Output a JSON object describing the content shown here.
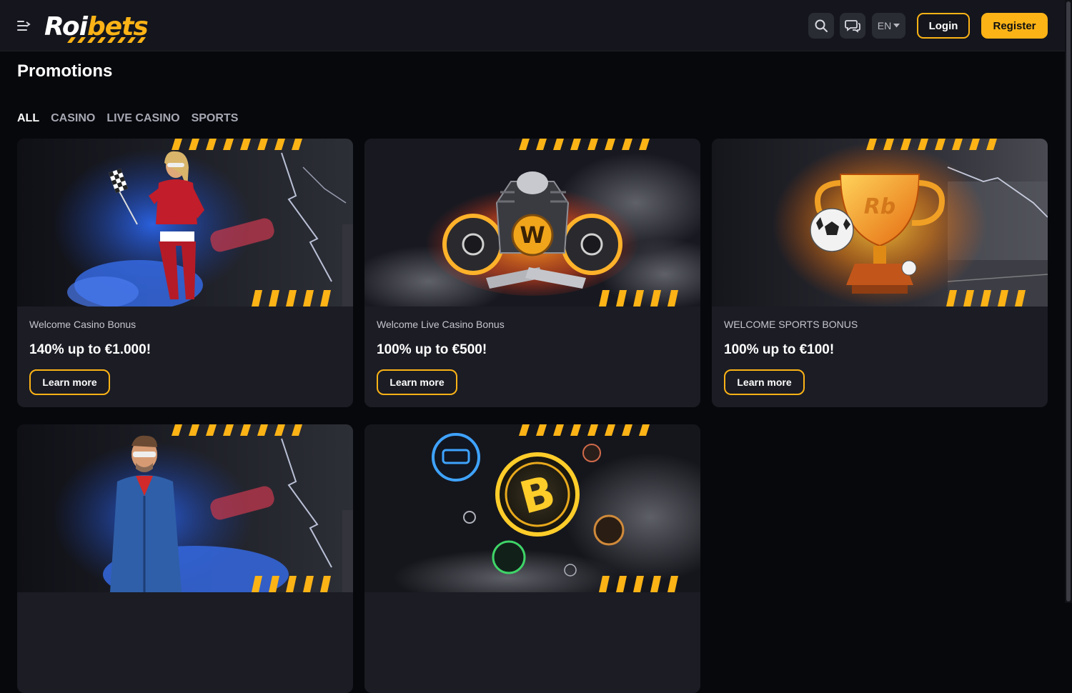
{
  "header": {
    "logo_part1": "Roi",
    "logo_part2": "bets",
    "language": "EN",
    "login_label": "Login",
    "register_label": "Register",
    "brand_color": "#fcb316",
    "icons": [
      "menu-icon",
      "search-icon",
      "chat-icon",
      "caret-down-icon"
    ]
  },
  "page": {
    "title": "Promotions"
  },
  "tabs": [
    {
      "label": "ALL",
      "active": true
    },
    {
      "label": "CASINO",
      "active": false
    },
    {
      "label": "LIVE CASINO",
      "active": false
    },
    {
      "label": "SPORTS",
      "active": false
    }
  ],
  "promotions": [
    {
      "category": "Welcome Casino Bonus",
      "title": "140% up to €1.000!",
      "button": "Learn more"
    },
    {
      "category": "Welcome Live Casino Bonus",
      "title": "100% up to €500!",
      "button": "Learn more"
    },
    {
      "category": "WELCOME SPORTS BONUS",
      "title": "100% up to €100!",
      "button": "Learn more"
    },
    {
      "category": "",
      "title": "",
      "button": ""
    },
    {
      "category": "",
      "title": "",
      "button": ""
    }
  ]
}
